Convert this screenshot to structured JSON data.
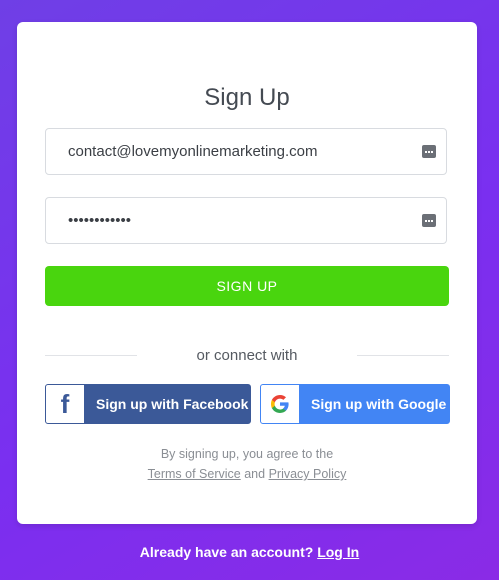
{
  "form": {
    "title": "Sign Up",
    "email_value": "contact@lovemyonlinemarketing.com",
    "password_value": "123456789012",
    "submit_label": "SIGN UP",
    "divider_text": "or connect with"
  },
  "social": {
    "facebook_label": "Sign up with Facebook",
    "google_label": "Sign up with Google"
  },
  "legal": {
    "prefix": "By signing up, you agree to the",
    "terms_link": "Terms of Service",
    "and_text": "and",
    "privacy_link": "Privacy Policy"
  },
  "footer": {
    "prompt": "Already have an account?",
    "login_link": "Log In"
  },
  "colors": {
    "background": "#7a2ff0",
    "signup_button": "#49d50e",
    "facebook": "#3b5998",
    "google": "#4285f4"
  },
  "icons": {
    "field_icon": "keyboard-icon",
    "facebook_logo": "facebook-logo-icon",
    "google_logo": "google-logo-icon"
  }
}
